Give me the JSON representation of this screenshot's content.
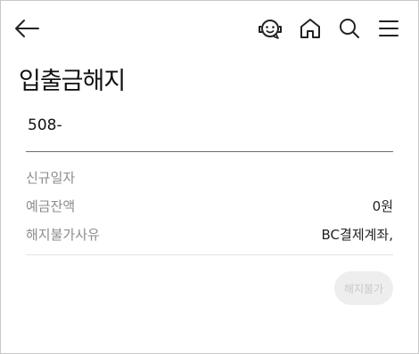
{
  "header": {
    "back_icon": "arrow-left-icon",
    "chatbot_icon": "chatbot-face-icon",
    "home_icon": "home-icon",
    "search_icon": "search-icon",
    "menu_icon": "hamburger-menu-icon"
  },
  "page": {
    "title": "입출금해지"
  },
  "account": {
    "number": "508-"
  },
  "info": {
    "rows": [
      {
        "label": "신규일자",
        "value": ""
      },
      {
        "label": "예금잔액",
        "value": "0원"
      },
      {
        "label": "해지불가사유",
        "value": "BC결제계좌,"
      }
    ]
  },
  "actions": {
    "terminate_label": "해지불가",
    "terminate_enabled": false
  },
  "colors": {
    "text_primary": "#111111",
    "label_gray": "#8c8c8c",
    "divider": "#e3e3e3",
    "disabled_button_bg": "#eeeeee",
    "disabled_button_text": "#c9c9c9"
  }
}
